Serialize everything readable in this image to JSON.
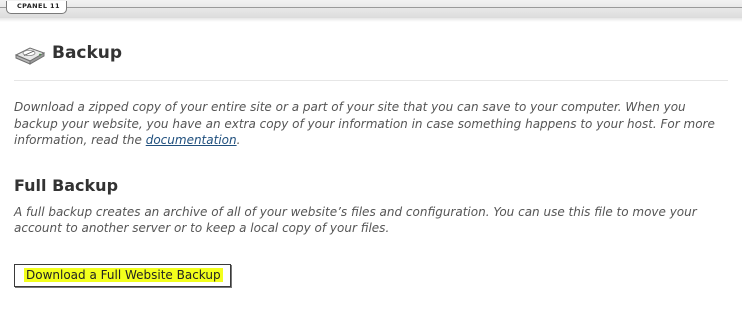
{
  "brand": {
    "label": "CPANEL 11"
  },
  "header": {
    "title": "Backup",
    "icon": "backup-drive-icon"
  },
  "intro": {
    "text_before_link": "Download a zipped copy of your entire site or a part of your site that you can save to your computer. When you backup your website, you have an extra copy of your information in case something happens to your host. For more information, read the ",
    "link_text": "documentation",
    "text_after_link": "."
  },
  "full_backup": {
    "title": "Full Backup",
    "description": "A full backup creates an archive of all of your website’s files and configuration. You can use this file to move your account to another server or to keep a local copy of your files.",
    "button_label": "Download a Full Website Backup"
  },
  "colors": {
    "link": "#1f4f7d",
    "highlight": "#f3ff1c",
    "text": "#555555",
    "heading": "#333333"
  }
}
